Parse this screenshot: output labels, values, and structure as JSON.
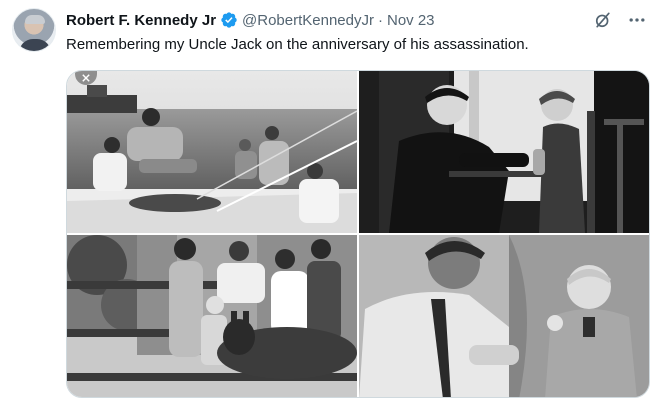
{
  "author": {
    "name": "Robert F. Kennedy Jr",
    "handle": "@RobertKennedyJr",
    "separator": "·",
    "date": "Nov 23"
  },
  "tweet": {
    "text": "Remembering my Uncle Jack on the anniversary of his assassination."
  },
  "media": {
    "photo_count": 4
  },
  "colors": {
    "verified": "#1d9bf0",
    "muted_text": "#536471",
    "border": "#cfd9de"
  },
  "icons": [
    "verified-badge-icon",
    "grok-icon",
    "more-icon",
    "close-icon"
  ]
}
